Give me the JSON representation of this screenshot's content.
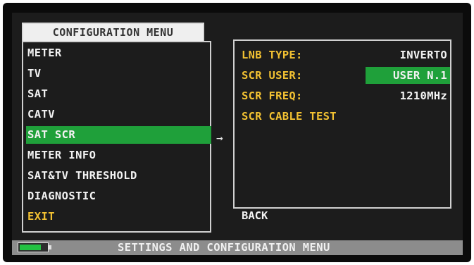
{
  "menu": {
    "title": "CONFIGURATION MENU",
    "items": [
      {
        "label": "METER"
      },
      {
        "label": "TV"
      },
      {
        "label": "SAT"
      },
      {
        "label": "CATV"
      },
      {
        "label": "SAT SCR"
      },
      {
        "label": "METER INFO"
      },
      {
        "label": "SAT&TV THRESHOLD"
      },
      {
        "label": "DIAGNOSTIC"
      },
      {
        "label": "EXIT"
      }
    ],
    "selected_index": 4
  },
  "arrow": "→",
  "panel": {
    "rows": [
      {
        "label": "LNB TYPE:",
        "value": "INVERTO"
      },
      {
        "label": "SCR USER:",
        "value": "USER N.1"
      },
      {
        "label": "SCR FREQ:",
        "value": "1210MHz"
      },
      {
        "label": "SCR CABLE TEST",
        "value": ""
      }
    ],
    "selected_row": 1,
    "back_label": "BACK"
  },
  "status": {
    "title": "SETTINGS AND CONFIGURATION MENU",
    "battery_level": 0.78
  },
  "colors": {
    "selection": "#1fa03a",
    "label_yellow": "#f2c132",
    "text": "#f2f2f2",
    "screen_bg": "#1c1c1c"
  }
}
